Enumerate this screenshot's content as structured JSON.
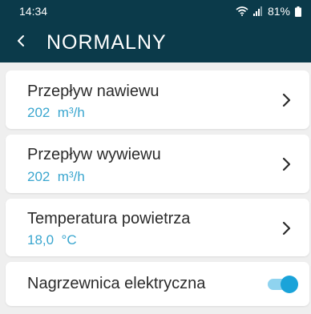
{
  "status_bar": {
    "time": "14:34",
    "battery": "81%",
    "icons": [
      "wifi-icon",
      "signal-icon",
      "battery-icon"
    ]
  },
  "header": {
    "title": "NORMALNY",
    "back_icon": "chevron-left-icon"
  },
  "items": [
    {
      "title": "Przepływ nawiewu",
      "value": "202  m³/h",
      "icon": "chevron-right-icon"
    },
    {
      "title": "Przepływ wywiewu",
      "value": "202  m³/h",
      "icon": "chevron-right-icon"
    },
    {
      "title": "Temperatura powietrza",
      "value": "18,0  °C",
      "icon": "chevron-right-icon"
    }
  ],
  "toggle_item": {
    "title": "Nagrzewnica elektryczna",
    "enabled": true
  },
  "colors": {
    "header_bg": "#0b3a4a",
    "value_text": "#3aa6cf",
    "toggle_on": "#1aa3d9"
  }
}
